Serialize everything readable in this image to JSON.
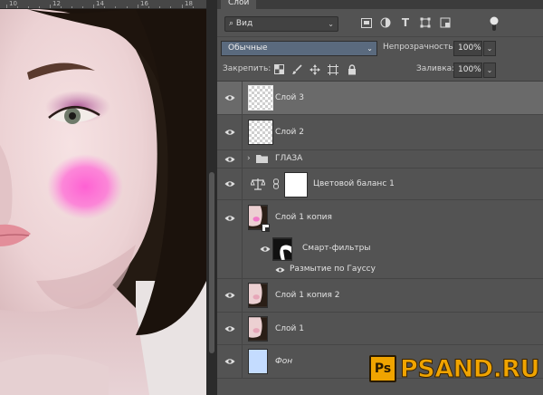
{
  "ruler": {
    "labels": [
      "10",
      "12",
      "14",
      "16",
      "18"
    ]
  },
  "panel": {
    "tab": "Слои"
  },
  "filter": {
    "kind_label": "Вид",
    "icons": [
      "image-filter-icon",
      "adjustment-filter-icon",
      "type-filter-icon",
      "shape-filter-icon",
      "smart-object-filter-icon"
    ]
  },
  "blend": {
    "mode": "Обычные",
    "opacity_label": "Непрозрачность:",
    "opacity_value": "100%"
  },
  "lock": {
    "label": "Закрепить:",
    "fill_label": "Заливка:",
    "fill_value": "100%"
  },
  "layers": [
    {
      "name": "Слой 3",
      "type": "pixel-transparent",
      "selected": true,
      "visible": true
    },
    {
      "name": "Слой 2",
      "type": "pixel-transparent",
      "selected": false,
      "visible": true
    },
    {
      "name": "ГЛАЗА",
      "type": "group",
      "selected": false,
      "visible": true
    },
    {
      "name": "Цветовой баланс 1",
      "type": "adjustment",
      "selected": false,
      "visible": true
    },
    {
      "name": "Слой 1 копия",
      "type": "smart-object",
      "selected": false,
      "visible": true
    },
    {
      "name": "Смарт-фильтры",
      "type": "smart-filters",
      "selected": false,
      "visible": true
    },
    {
      "name": "Размытие по Гауссу",
      "type": "filter",
      "selected": false,
      "visible": true
    },
    {
      "name": "Слой 1 копия 2",
      "type": "pixel-photo",
      "selected": false,
      "visible": true
    },
    {
      "name": "Слой 1",
      "type": "pixel-photo",
      "selected": false,
      "visible": true
    },
    {
      "name": "Фон",
      "type": "background",
      "selected": false,
      "visible": true
    }
  ],
  "watermark": {
    "logo": "Ps",
    "text": "PSAND.RU"
  },
  "colors": {
    "panel_bg": "#535353",
    "selected_layer": "#6a6a6a",
    "blend_select": "#5a6a7e",
    "blush": "#ff5ad2",
    "background_layer": "#c4dcff",
    "watermark": "#f0a400"
  }
}
